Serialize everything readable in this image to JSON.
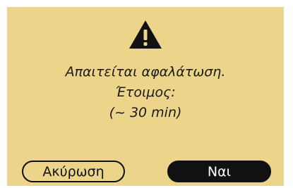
{
  "dialog": {
    "icon": "warning-triangle-icon",
    "message_lines": [
      "Απαιτείται αφαλάτωση.",
      "Έτοιμος:",
      "(~ 30 min)"
    ],
    "cancel_label": "Ακύρωση",
    "confirm_label": "Ναι"
  },
  "colors": {
    "background": "#ecd48a",
    "text": "#1a1a1a",
    "button_dark": "#111111",
    "button_text_light": "#ffffff"
  }
}
